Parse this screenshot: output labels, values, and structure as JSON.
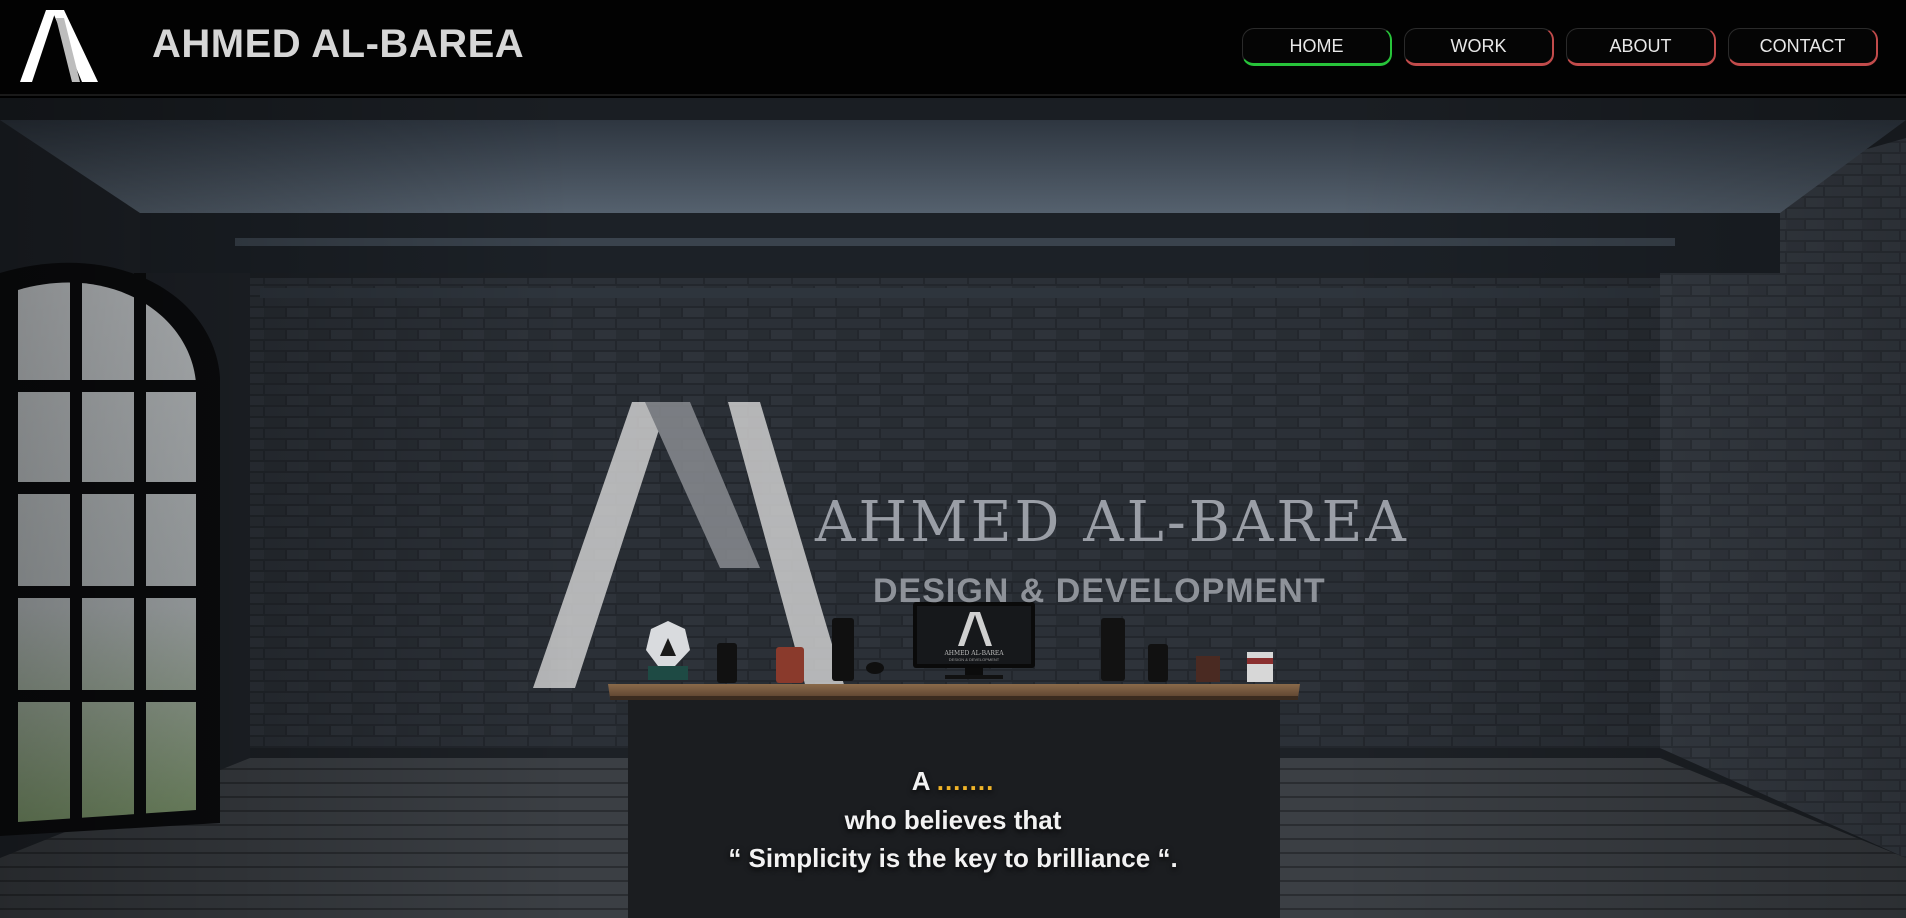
{
  "header": {
    "brand": "AHMED AL-BAREA"
  },
  "nav": {
    "items": [
      {
        "label": "HOME",
        "active": true
      },
      {
        "label": "WORK",
        "active": false
      },
      {
        "label": "ABOUT",
        "active": false
      },
      {
        "label": "CONTACT",
        "active": false
      }
    ]
  },
  "hero": {
    "wall_title": "AHMED AL-BAREA",
    "wall_subtitle": "DESIGN & DEVELOPMENT",
    "monitor_title": "AHMED AL-BAREA",
    "monitor_subtitle": "DESIGN & DEVELOPMENT",
    "tagline_prefix": "A",
    "tagline_dots": ".......",
    "tagline_line2": "who believes that",
    "tagline_line3": "“ Simplicity is the key to brilliance “."
  },
  "colors": {
    "active_accent": "#27c43a",
    "inactive_accent": "#c24b4b",
    "dots_accent": "#f0b429"
  }
}
